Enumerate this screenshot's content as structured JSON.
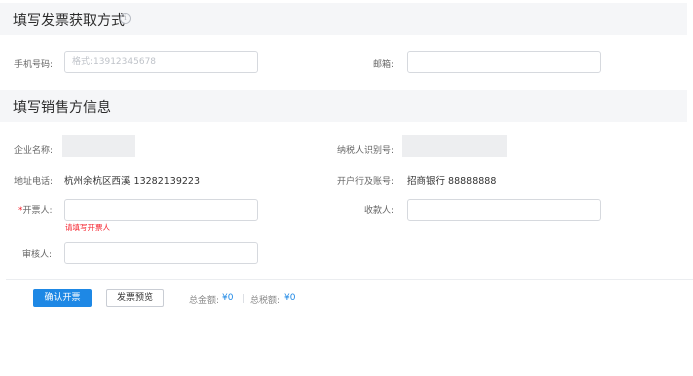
{
  "section_receive": {
    "title": "填写发票获取方式",
    "info_icon": "info-circle-icon",
    "phone_label": "手机号码:",
    "phone_placeholder": "格式:13912345678",
    "phone_value": "",
    "email_label": "邮箱:",
    "email_value": ""
  },
  "section_seller": {
    "title": "填写销售方信息",
    "company_label": "企业名称:",
    "taxid_label": "纳税人识别号:",
    "address_label": "地址电话:",
    "address_value": "杭州余杭区西溪 13282139223",
    "bank_label": "开户行及账号:",
    "bank_value": "招商银行 88888888",
    "drawer_required_mark": "*",
    "drawer_label": "开票人:",
    "drawer_value": "",
    "drawer_error": "请填写开票人",
    "payee_label": "收款人:",
    "payee_value": "",
    "reviewer_label": "审核人:",
    "reviewer_value": ""
  },
  "footer": {
    "confirm_label": "确认开票",
    "preview_label": "发票预览",
    "total_label": "总金额:",
    "total_value": "¥0",
    "tax_label": "总税额:",
    "tax_value": "¥0"
  },
  "colors": {
    "primary": "#1e88e5",
    "error": "#f5222d",
    "section_bg": "#f5f6f8"
  }
}
